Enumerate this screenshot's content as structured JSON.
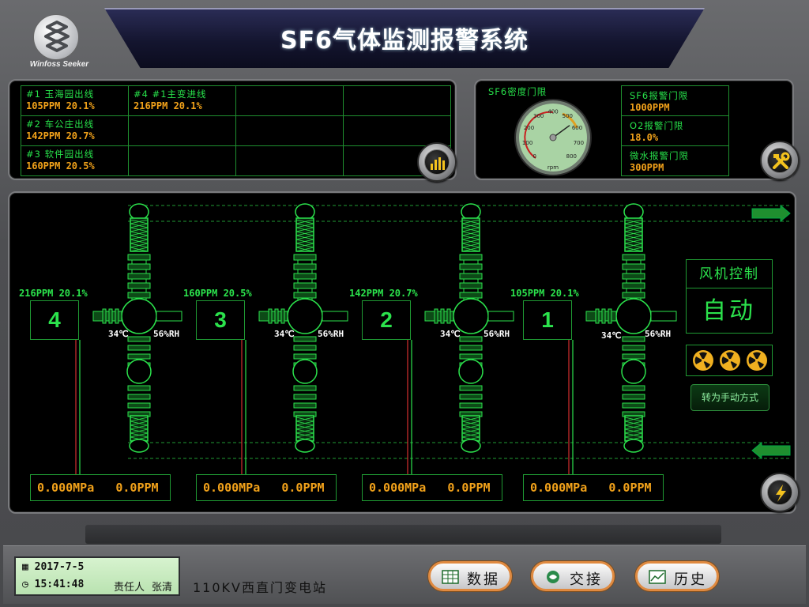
{
  "header": {
    "logo_text": "Winfoss Seeker",
    "title": "SF6气体监测报警系统"
  },
  "lines": [
    {
      "name": "#1 玉海园出线",
      "value": "105PPM 20.1%"
    },
    {
      "name": "#4 #1主变进线",
      "value": "216PPM 20.1%"
    },
    {
      "name": "#2 车公庄出线",
      "value": "142PPM 20.7%"
    },
    {
      "name": "#3 软件园出线",
      "value": "160PPM 20.5%"
    }
  ],
  "limits": {
    "density_label": "SF6密度门限",
    "gauge": {
      "ticks": [
        "0",
        "100",
        "200",
        "300",
        "400",
        "500",
        "600",
        "700",
        "800"
      ],
      "unit": "rpm",
      "value": 560
    },
    "items": [
      {
        "name": "SF6报警门限",
        "value": "1000PPM"
      },
      {
        "name": "O2报警门限",
        "value": "18.0%"
      },
      {
        "name": "微水报警门限",
        "value": "300PPM"
      }
    ]
  },
  "bays": [
    {
      "number": "4",
      "reading_num": "216",
      "reading_unit": "PPM 20.1%",
      "temp": "34℃",
      "rh": "56%RH",
      "pressure": "0.000",
      "ppm": "0.0"
    },
    {
      "number": "3",
      "reading_num": "160",
      "reading_unit": "PPM 20.5%",
      "temp": "34℃",
      "rh": "56%RH",
      "pressure": "0.000",
      "ppm": "0.0"
    },
    {
      "number": "2",
      "reading_num": "142",
      "reading_unit": "PPM 20.7%",
      "temp": "34℃",
      "rh": "56%RH",
      "pressure": "0.000",
      "ppm": "0.0"
    },
    {
      "number": "1",
      "reading_num": "105",
      "reading_unit": "PPM 20.1%",
      "temp": "34℃",
      "rh": "56%RH",
      "pressure": "0.000",
      "ppm": "0.0"
    }
  ],
  "units": {
    "pressure": "MPa",
    "ppm": "PPM"
  },
  "fan": {
    "title": "风机控制",
    "mode": "自动",
    "switch_label": "转为手动方式"
  },
  "status": {
    "date": "2017-7-5",
    "time": "15:41:48",
    "owner_label": "责任人",
    "owner_name": "张清",
    "station": "110KV西直门变电站"
  },
  "nav": [
    {
      "label": "数据",
      "icon": "table-icon"
    },
    {
      "label": "交接",
      "icon": "handover-icon"
    },
    {
      "label": "历史",
      "icon": "history-chart-icon"
    }
  ],
  "colors": {
    "accent_green": "#2be24c",
    "value_orange": "#f2a21a",
    "button_border": "#e08a40"
  }
}
